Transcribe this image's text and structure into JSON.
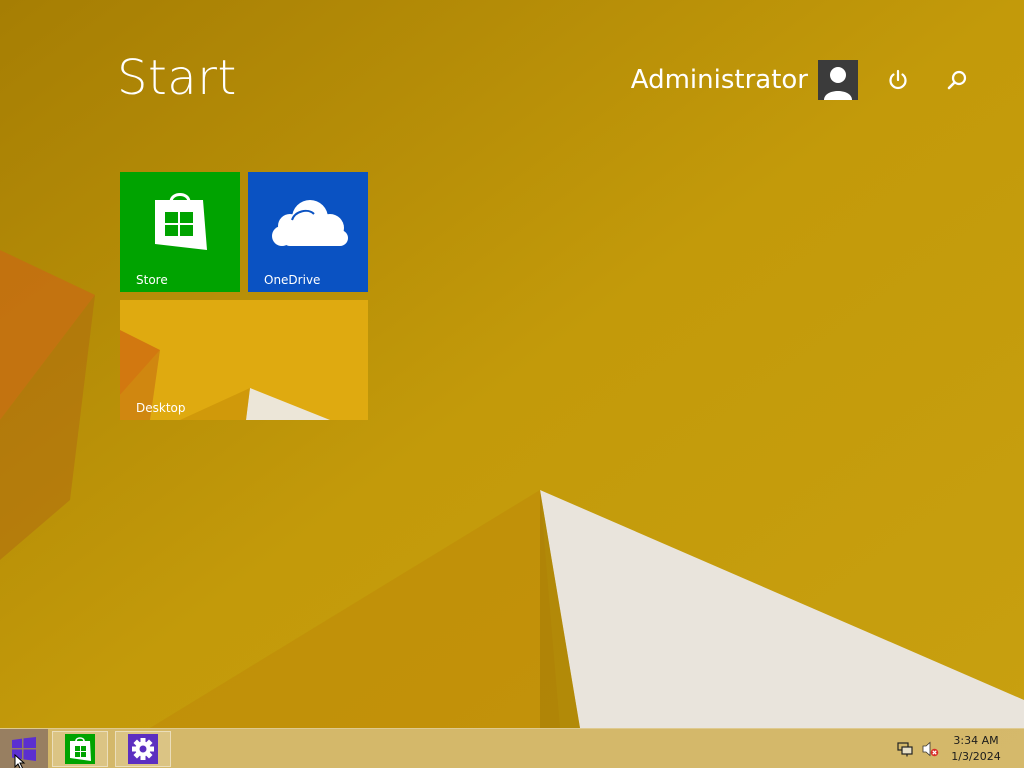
{
  "start": {
    "title": "Start"
  },
  "user": {
    "name": "Administrator",
    "avatar_icon": "user-silhouette-icon"
  },
  "header": {
    "power_icon": "power-icon",
    "search_icon": "search-icon"
  },
  "tiles": [
    {
      "label": "Store",
      "icon": "store-bag-icon",
      "color": "#00a300"
    },
    {
      "label": "OneDrive",
      "icon": "cloud-icon",
      "color": "#0a52c2"
    },
    {
      "label": "Desktop",
      "icon": "desktop-wallpaper-preview",
      "color": "#d9a40a"
    }
  ],
  "taskbar": {
    "start_icon": "windows-logo-icon",
    "pinned": [
      {
        "name": "Store",
        "icon": "store-bag-icon"
      },
      {
        "name": "Settings",
        "icon": "gear-icon"
      }
    ],
    "tray": [
      {
        "name": "network-icon"
      },
      {
        "name": "speaker-muted-icon"
      }
    ],
    "clock": {
      "time": "3:34 AM",
      "date": "1/3/2024"
    }
  },
  "colors": {
    "background": "#b88f06",
    "store_tile": "#00a300",
    "onedrive_tile": "#0a52c2",
    "start_button_accent": "#5b2fd0"
  }
}
